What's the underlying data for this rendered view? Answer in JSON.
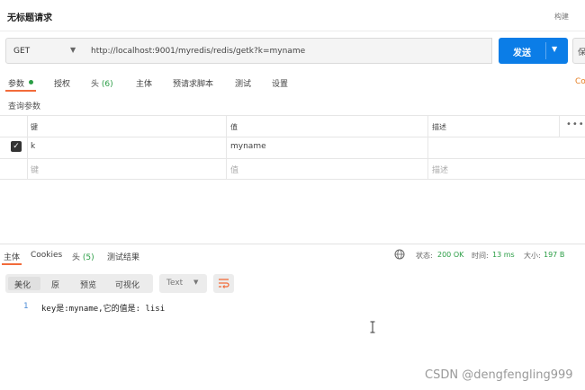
{
  "header": {
    "title": "无标题请求",
    "build_label": "构建"
  },
  "request": {
    "method": "GET",
    "url": "http://localhost:9001/myredis/redis/getk?k=myname",
    "send_label": "发送",
    "save_label": "保"
  },
  "request_tabs": {
    "params": "参数",
    "auth": "授权",
    "headers": "头",
    "headers_count": "(6)",
    "body": "主体",
    "prerequest": "预请求脚本",
    "tests": "测试",
    "settings": "设置",
    "cookies_link": "Co"
  },
  "query_params": {
    "label": "查询参数",
    "columns": {
      "key": "键",
      "value": "值",
      "description": "描述"
    },
    "rows": [
      {
        "key": "k",
        "value": "myname",
        "description": ""
      }
    ],
    "placeholder": {
      "key": "键",
      "value": "值",
      "description": "描述"
    }
  },
  "response_tabs": {
    "body": "主体",
    "cookies": "Cookies",
    "headers": "头",
    "headers_count": "(5)",
    "test_results": "测试结果"
  },
  "response_meta": {
    "status_label": "状态:",
    "status_value": "200 OK",
    "time_label": "时间:",
    "time_value": "13 ms",
    "size_label": "大小:",
    "size_value": "197 B"
  },
  "response_toolbar": {
    "pretty": "美化",
    "raw": "原",
    "preview": "预览",
    "visualize": "可视化",
    "format": "Text"
  },
  "response_body": {
    "line_number": "1",
    "text": "key是:myname,它的值是: lisi"
  },
  "watermark": "CSDN @dengfengling999",
  "colors": {
    "accent": "#f26b3a",
    "send": "#0b7de7",
    "success": "#2a9d45"
  }
}
